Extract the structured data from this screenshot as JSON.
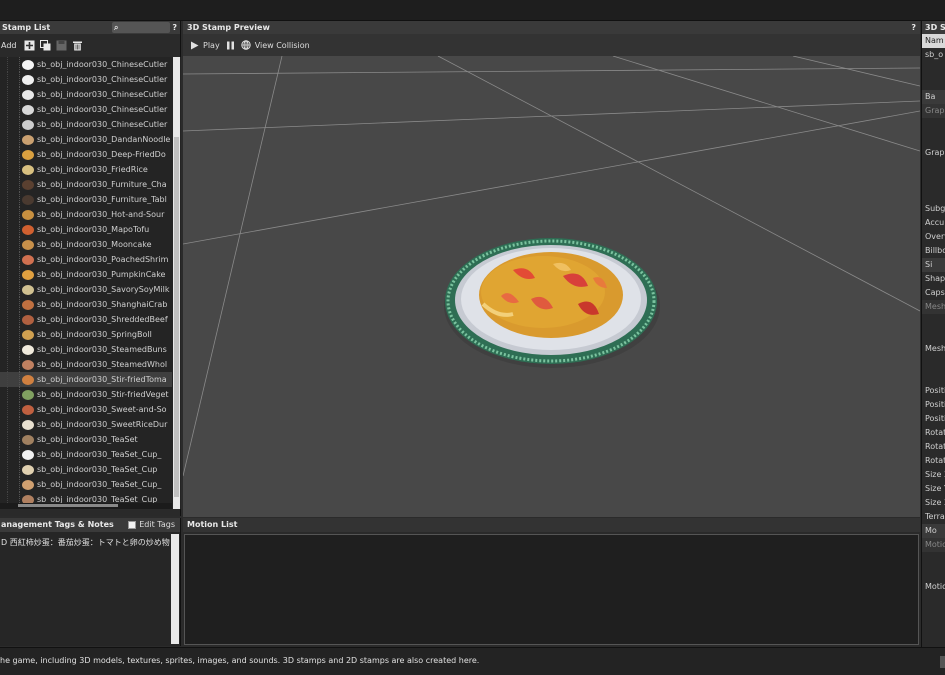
{
  "stamp_list": {
    "title": "Stamp List",
    "help": "?",
    "add_label": "Add",
    "items": [
      {
        "label": "sb_obj_indoor030_ChineseCutler",
        "color": "#f5f5f5"
      },
      {
        "label": "sb_obj_indoor030_ChineseCutler",
        "color": "#f0f0f0"
      },
      {
        "label": "sb_obj_indoor030_ChineseCutler",
        "color": "#e8e8e8"
      },
      {
        "label": "sb_obj_indoor030_ChineseCutler",
        "color": "#d8d8d8"
      },
      {
        "label": "sb_obj_indoor030_ChineseCutler",
        "color": "#cccccc"
      },
      {
        "label": "sb_obj_indoor030_DandanNoodle",
        "color": "#caa070"
      },
      {
        "label": "sb_obj_indoor030_Deep-FriedDo",
        "color": "#d9a040"
      },
      {
        "label": "sb_obj_indoor030_FriedRice",
        "color": "#d8c080"
      },
      {
        "label": "sb_obj_indoor030_Furniture_Cha",
        "color": "#5a4030"
      },
      {
        "label": "sb_obj_indoor030_Furniture_Tabl",
        "color": "#4a3a30"
      },
      {
        "label": "sb_obj_indoor030_Hot-and-Sour",
        "color": "#c89040"
      },
      {
        "label": "sb_obj_indoor030_MapoTofu",
        "color": "#d06030"
      },
      {
        "label": "sb_obj_indoor030_Mooncake",
        "color": "#c8904a"
      },
      {
        "label": "sb_obj_indoor030_PoachedShrim",
        "color": "#d07050"
      },
      {
        "label": "sb_obj_indoor030_PumpkinCake",
        "color": "#e0a040"
      },
      {
        "label": "sb_obj_indoor030_SavorySoyMilk",
        "color": "#d0c090"
      },
      {
        "label": "sb_obj_indoor030_ShanghaiCrab",
        "color": "#c07040"
      },
      {
        "label": "sb_obj_indoor030_ShreddedBeef",
        "color": "#b06040"
      },
      {
        "label": "sb_obj_indoor030_SpringBoll",
        "color": "#d0a050"
      },
      {
        "label": "sb_obj_indoor030_SteamedBuns",
        "color": "#f0eadc"
      },
      {
        "label": "sb_obj_indoor030_SteamedWhol",
        "color": "#c08060"
      },
      {
        "label": "sb_obj_indoor030_Stir-friedToma",
        "color": "#d08040",
        "selected": true
      },
      {
        "label": "sb_obj_indoor030_Stir-friedVeget",
        "color": "#80a060"
      },
      {
        "label": "sb_obj_indoor030_Sweet-and-So",
        "color": "#c06040"
      },
      {
        "label": "sb_obj_indoor030_SweetRiceDur",
        "color": "#e8e0d0"
      },
      {
        "label": "sb_obj_indoor030_TeaSet",
        "color": "#a08060"
      },
      {
        "label": "sb_obj_indoor030_TeaSet_Cup_",
        "color": "#f0f0f0"
      },
      {
        "label": "sb_obj_indoor030_TeaSet_Cup",
        "color": "#e0d0b0"
      },
      {
        "label": "sb_obj_indoor030_TeaSet_Cup_",
        "color": "#d0a070"
      },
      {
        "label": "sb_obj_indoor030_TeaSet_Cup_",
        "color": "#b08060"
      }
    ]
  },
  "preview": {
    "title": "3D Stamp Preview",
    "help": "?",
    "play_label": "Play",
    "collision_label": "View Collision"
  },
  "inspector": {
    "title": "3D St",
    "rows": [
      {
        "text": "Nam",
        "style": "field"
      },
      {
        "text": "sb_o",
        "style": "plain"
      },
      {
        "text": "",
        "style": "plain"
      },
      {
        "text": "",
        "style": "plain"
      },
      {
        "text": "Ba",
        "style": "section"
      },
      {
        "text": "Graph",
        "style": "dim"
      },
      {
        "text": "",
        "style": "plain"
      },
      {
        "text": "",
        "style": "plain"
      },
      {
        "text": "Graph",
        "style": "plain"
      },
      {
        "text": "",
        "style": "plain"
      },
      {
        "text": "",
        "style": "plain"
      },
      {
        "text": "",
        "style": "plain"
      },
      {
        "text": "Subg",
        "style": "plain"
      },
      {
        "text": "Accu",
        "style": "plain"
      },
      {
        "text": "Overv",
        "style": "plain"
      },
      {
        "text": "Billbo",
        "style": "plain"
      },
      {
        "text": "Si",
        "style": "section"
      },
      {
        "text": "Shap",
        "style": "plain"
      },
      {
        "text": "Caps",
        "style": "plain"
      },
      {
        "text": "Mesh",
        "style": "dim"
      },
      {
        "text": "",
        "style": "plain"
      },
      {
        "text": "",
        "style": "plain"
      },
      {
        "text": "Mesh",
        "style": "plain"
      },
      {
        "text": "",
        "style": "plain"
      },
      {
        "text": "",
        "style": "plain"
      },
      {
        "text": "Positi",
        "style": "plain"
      },
      {
        "text": "Positi",
        "style": "plain"
      },
      {
        "text": "Positi",
        "style": "plain"
      },
      {
        "text": "Rotat",
        "style": "plain"
      },
      {
        "text": "Rotat",
        "style": "plain"
      },
      {
        "text": "Rotat",
        "style": "plain"
      },
      {
        "text": "Size 2",
        "style": "plain"
      },
      {
        "text": "Size Y",
        "style": "plain"
      },
      {
        "text": "Size 2",
        "style": "plain"
      },
      {
        "text": "Terra",
        "style": "plain"
      },
      {
        "text": "Mo",
        "style": "section"
      },
      {
        "text": "Motic",
        "style": "dim"
      },
      {
        "text": "",
        "style": "plain"
      },
      {
        "text": "",
        "style": "plain"
      },
      {
        "text": "Motio",
        "style": "plain"
      }
    ]
  },
  "notes": {
    "title": "anagement Tags & Notes",
    "edit_tags_label": "Edit Tags",
    "content": "D 西紅柿炒蛋：番茄炒蛋：トマトと卵の炒め物"
  },
  "motion": {
    "title": "Motion List"
  },
  "status": {
    "text": "he game, including 3D models, textures, sprites, images, and sounds. 3D stamps and 2D stamps are also created here."
  }
}
